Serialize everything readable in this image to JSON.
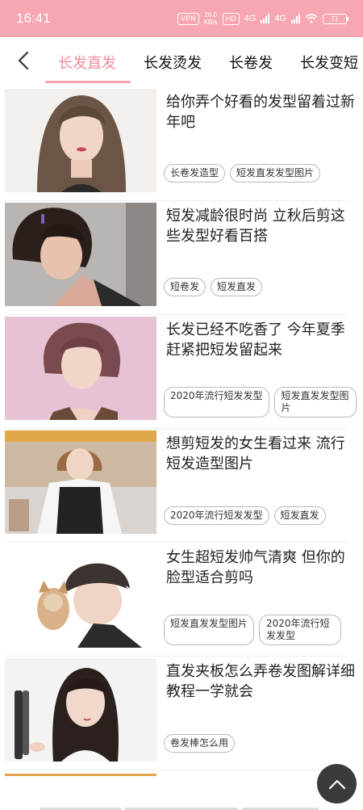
{
  "status_bar": {
    "time": "16:41",
    "vpn": "VPN",
    "speed_value": "26.0",
    "speed_unit": "KB/s",
    "hd": "HD",
    "net1": "4G",
    "net2": "4G",
    "battery": "71"
  },
  "nav": {
    "tabs": [
      {
        "label": "长发直发",
        "active": true
      },
      {
        "label": "长发烫发",
        "active": false
      },
      {
        "label": "长卷发",
        "active": false
      },
      {
        "label": "长发变短",
        "active": false
      }
    ]
  },
  "articles": [
    {
      "title": "给你弄个好看的发型留着过新年吧",
      "tags": [
        "长卷发造型",
        "短发直发发型图片"
      ]
    },
    {
      "title": "短发减龄很时尚 立秋后剪这些发型好看百搭",
      "tags": [
        "短卷发",
        "短发直发"
      ]
    },
    {
      "title": "长发已经不吃香了 今年夏季赶紧把短发留起来",
      "tags": [
        "2020年流行短发发型",
        "短发直发发型图片"
      ]
    },
    {
      "title": "想剪短发的女生看过来 流行短发造型图片",
      "tags": [
        "2020年流行短发发型",
        "短发直发"
      ]
    },
    {
      "title": "女生超短发帅气清爽 但你的脸型适合剪吗",
      "tags": [
        "短发直发发型图片",
        "2020年流行短发发型"
      ]
    },
    {
      "title": "直发夹板怎么弄卷发图解详细教程一学就会",
      "tags": [
        "卷发棒怎么用"
      ]
    }
  ],
  "colors": {
    "accent": "#f28b9b",
    "status_bar": "#f7a7b1"
  },
  "icons": {
    "back": "chevron-left-icon",
    "fab": "chevron-up-icon"
  }
}
